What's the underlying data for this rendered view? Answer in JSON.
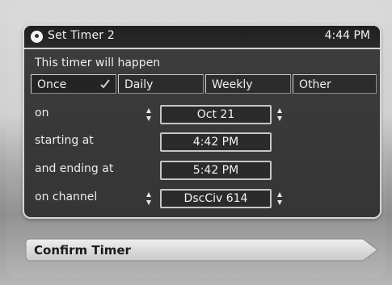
{
  "window": {
    "title": "Set Timer 2",
    "clock": "4:44 PM",
    "icon": "app-icon"
  },
  "intro_text": "This timer will happen",
  "frequency_tabs": {
    "selected": "Once",
    "items": [
      {
        "label": "Once",
        "checked": true
      },
      {
        "label": "Daily",
        "checked": false
      },
      {
        "label": "Weekly",
        "checked": false
      },
      {
        "label": "Other",
        "checked": false
      }
    ]
  },
  "rows": {
    "date": {
      "label": "on",
      "value": "Oct 21"
    },
    "start": {
      "label": "starting at",
      "value": "4:42 PM"
    },
    "end": {
      "label": "and ending at",
      "value": "5:42 PM"
    },
    "channel": {
      "label": "on channel",
      "value": "DscCiv 614"
    }
  },
  "confirm_button": {
    "label": "Confirm Timer"
  },
  "colors": {
    "panel": "#3a3a3a",
    "titlebar": "#222222",
    "border": "#d7d7d7",
    "confirm": "#d6d6d6"
  }
}
